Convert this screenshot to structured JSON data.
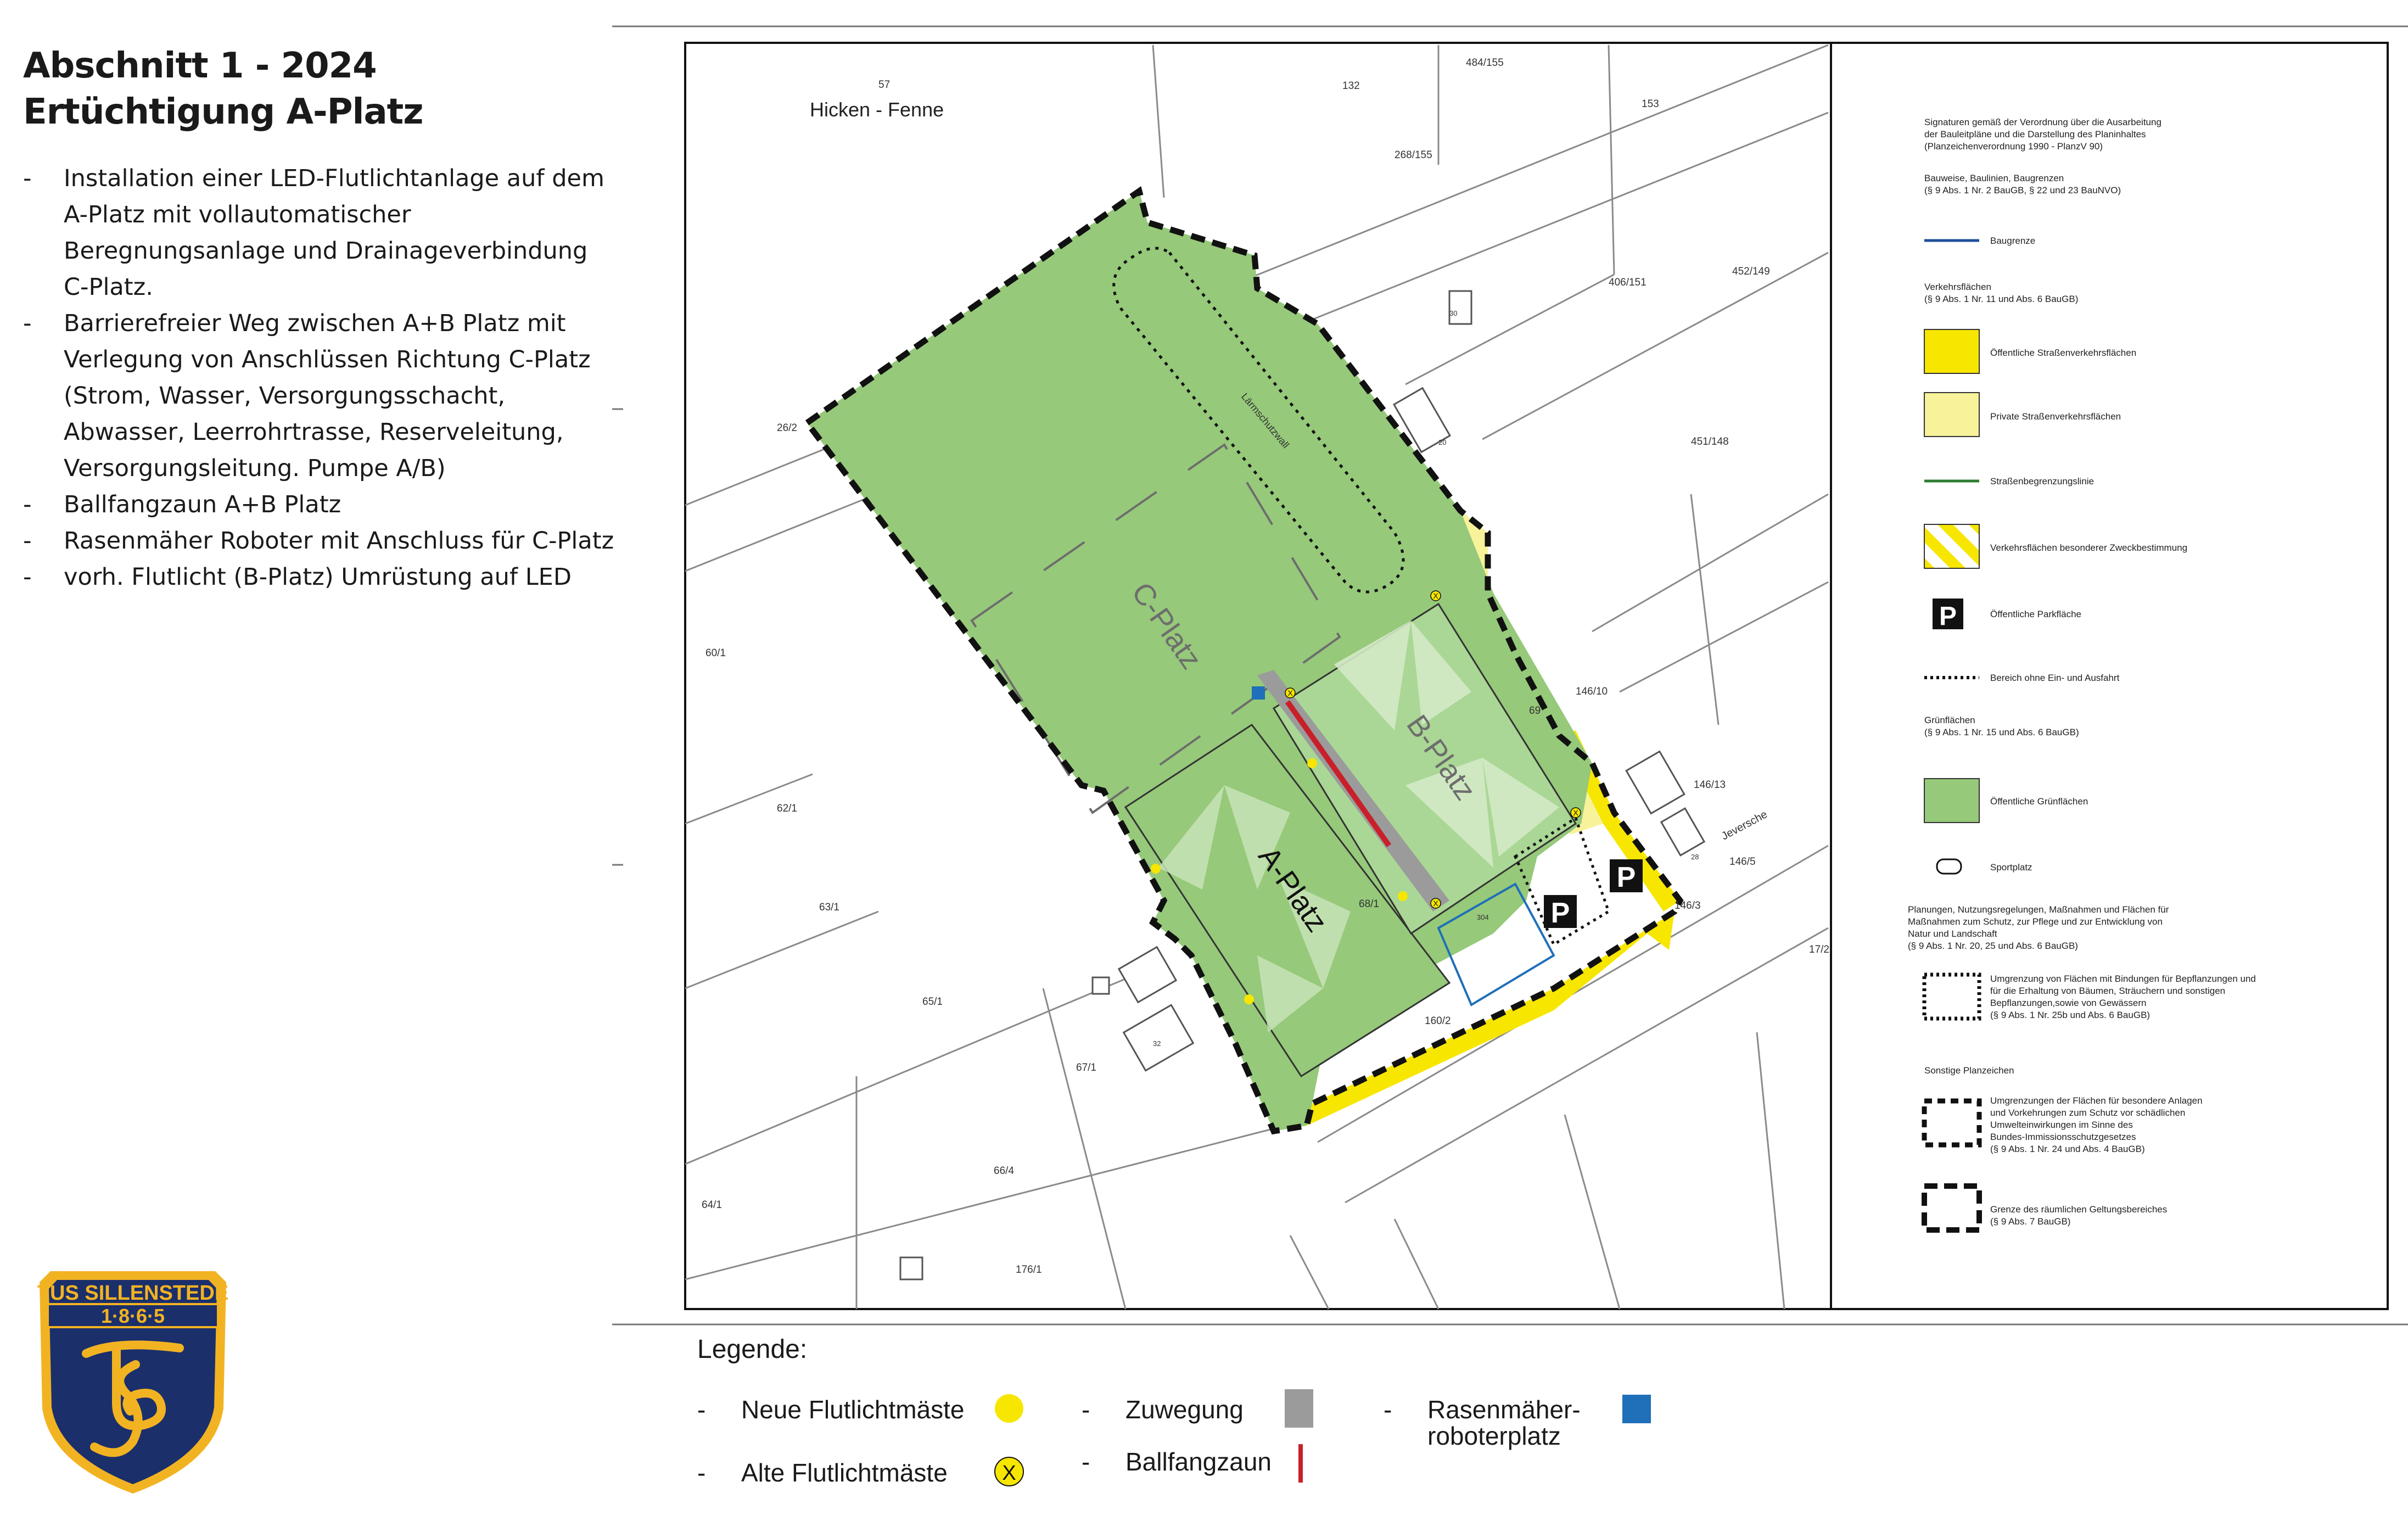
{
  "title": {
    "line1": "Abschnitt 1 - 2024",
    "line2": "Ertüchtigung A-Platz"
  },
  "bullets": [
    {
      "dash": "-",
      "text": "Installation einer LED-Flutlichtanlage auf dem A-Platz mit vollautomatischer Beregnungsanlage und Drainageverbindung C-Platz."
    },
    {
      "dash": "-",
      "text": "Barrierefreier Weg zwischen A+B Platz mit Verlegung von Anschlüssen Richtung C-Platz (Strom, Wasser, Versorgungsschacht, Abwasser, Leerrohrtrasse, Reserveleitung, Versorgungsleitung. Pumpe A/B)"
    },
    {
      "dash": "-",
      "text": "Ballfangzaun A+B Platz"
    },
    {
      "dash": "-",
      "text": "Rasenmäher Roboter mit Anschluss für C-Platz"
    },
    {
      "dash": "-",
      "text": "vorh. Flutlicht (B-Platz) Umrüstung auf LED"
    }
  ],
  "map": {
    "place_name": "Hicken - Fenne",
    "fields": {
      "a": "A-Platz",
      "b": "B-Platz",
      "c": "C-Platz"
    },
    "laermschutzwall": "Lärmschutzwall",
    "road": "Jeversche",
    "parcels": [
      "57",
      "132",
      "484/155",
      "153",
      "268/155",
      "406/151",
      "452/149",
      "451/148",
      "26/2",
      "60/1",
      "62/1",
      "63/1",
      "65/1",
      "67/1",
      "66/4",
      "64/1",
      "176/1",
      "69",
      "146/10",
      "146/13",
      "146/5",
      "146/3",
      "17/2",
      "68/1",
      "160/2",
      "20",
      "30",
      "32",
      "28",
      "304"
    ],
    "parking": "P",
    "old_light": "X"
  },
  "plan_legend": {
    "intro": [
      "Signaturen gemäß der Verordnung über die Ausarbeitung",
      "der Bauleitpläne und die Darstellung des Planinhaltes",
      "(Planzeichenverordnung 1990 - PlanzV 90)"
    ],
    "bauweise": [
      "Bauweise, Baulinien, Baugrenzen",
      "(§ 9 Abs. 1 Nr. 2 BauGB, § 22 und 23 BauNVO)"
    ],
    "baugrenze": "Baugrenze",
    "verkehr": [
      "Verkehrsflächen",
      "(§ 9 Abs. 1 Nr. 11 und Abs. 6 BauGB)"
    ],
    "oeff_strasse": "Öffentliche Straßenverkehrsflächen",
    "priv_strasse": "Private Straßenverkehrsflächen",
    "strassenbegrenzung": "Straßenbegrenzungslinie",
    "zweck": "Verkehrsflächen besonderer Zweckbestimmung",
    "parkflaeche": "Öffentliche Parkfläche",
    "ein_ausfahrt": "Bereich ohne Ein- und Ausfahrt",
    "gruen": [
      "Grünflächen",
      "(§ 9 Abs. 1 Nr. 15 und Abs. 6 BauGB)"
    ],
    "oeff_gruen": "Öffentliche Grünflächen",
    "sportplatz": "Sportplatz",
    "planungen": [
      "Planungen, Nutzungsregelungen, Maßnahmen und Flächen für",
      "Maßnahmen zum Schutz, zur Pflege und zur Entwicklung von",
      "Natur und Landschaft",
      "(§ 9 Abs. 1 Nr. 20, 25 und Abs. 6 BauGB)"
    ],
    "bepflanzung": [
      "Umgrenzung von Flächen mit Bindungen für Bepflanzungen und",
      "für die Erhaltung von Bäumen, Sträuchern und sonstigen",
      "Bepflanzungen,sowie von Gewässern",
      "(§ 9 Abs. 1 Nr. 25b und Abs. 6 BauGB)"
    ],
    "sonstige": "Sonstige Planzeichen",
    "umgrenzung": [
      "Umgrenzungen der Flächen für besondere Anlagen",
      "und Vorkehrungen zum Schutz vor schädlichen",
      "Umwelteinwirkungen im Sinne des",
      "Bundes-Immissionsschutzgesetzes",
      "(§ 9 Abs. 1 Nr. 24 und Abs. 4 BauGB)"
    ],
    "geltung": [
      "Grenze des räumlichen Geltungsbereiches",
      "(§ 9 Abs. 7 BauGB)"
    ]
  },
  "legend": {
    "title": "Legende:",
    "dash": "-",
    "neue": "Neue Flutlichtmäste",
    "alte": "Alte Flutlichtmäste",
    "alte_mark": "X",
    "zuwegung": "Zuwegung",
    "ballfang": "Ballfangzaun",
    "robot_1": "Rasenmäher-",
    "robot_2": "roboterplatz"
  },
  "logo": {
    "name": "TUS SILLENSTEDE",
    "year": "1·8·6·5",
    "monogram": "TS"
  },
  "colors": {
    "green": "#96c97a",
    "light_green": "#aad795",
    "yellow": "#f7e600",
    "pale_yellow": "#f8f29a",
    "red": "#c8202a",
    "blue": "#1f6fb9",
    "grey": "#9b9b9b",
    "navy": "#1b2f6b",
    "gold": "#f2b322"
  }
}
